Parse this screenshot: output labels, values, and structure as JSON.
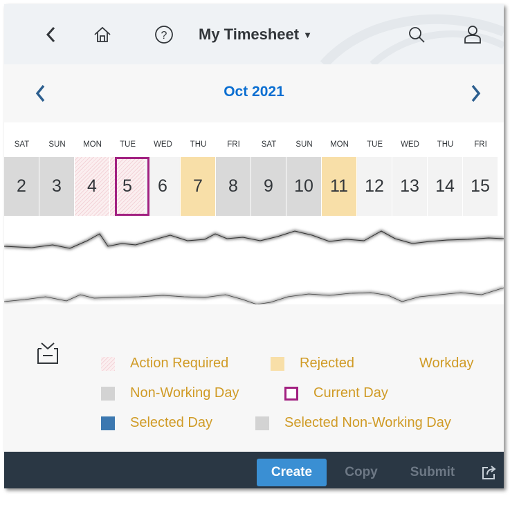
{
  "shell": {
    "title": "My Timesheet",
    "caret": "▼",
    "icons": [
      "back-icon",
      "home-icon",
      "help-icon",
      "search-icon",
      "user-icon"
    ]
  },
  "calendar": {
    "month_label": "Oct 2021",
    "weekdays": [
      "SAT",
      "SUN",
      "MON",
      "TUE",
      "WED",
      "THU",
      "FRI",
      "SAT",
      "SUN",
      "MON",
      "TUE",
      "WED",
      "THU",
      "FRI"
    ],
    "days": [
      {
        "num": "2",
        "status": "nonwork"
      },
      {
        "num": "3",
        "status": "nonwork"
      },
      {
        "num": "4",
        "status": "action"
      },
      {
        "num": "5",
        "status": "current"
      },
      {
        "num": "6",
        "status": "work"
      },
      {
        "num": "7",
        "status": "rejected"
      },
      {
        "num": "8",
        "status": "nonwork"
      },
      {
        "num": "9",
        "status": "nonwork"
      },
      {
        "num": "10",
        "status": "nonwork"
      },
      {
        "num": "11",
        "status": "rejected"
      },
      {
        "num": "12",
        "status": "work"
      },
      {
        "num": "13",
        "status": "work"
      },
      {
        "num": "14",
        "status": "work"
      },
      {
        "num": "15",
        "status": "work"
      }
    ]
  },
  "legend": {
    "action_required": "Action Required",
    "rejected": "Rejected",
    "workday": "Workday",
    "non_working_day": "Non-Working Day",
    "current_day": "Current Day",
    "selected_day": "Selected Day",
    "selected_non_working_day": "Selected Non-Working Day"
  },
  "footer": {
    "create": "Create",
    "copy": "Copy",
    "submit": "Submit"
  },
  "colors": {
    "accent": "#0a6ed1",
    "legend_text": "#d09b26",
    "current_day_border": "#a22181",
    "rejected": "#f8dfa8",
    "non_working": "#d9d9d9",
    "selected": "#3c78b0",
    "footer_bg": "#2a3744",
    "create_button": "#3a8fd3"
  }
}
